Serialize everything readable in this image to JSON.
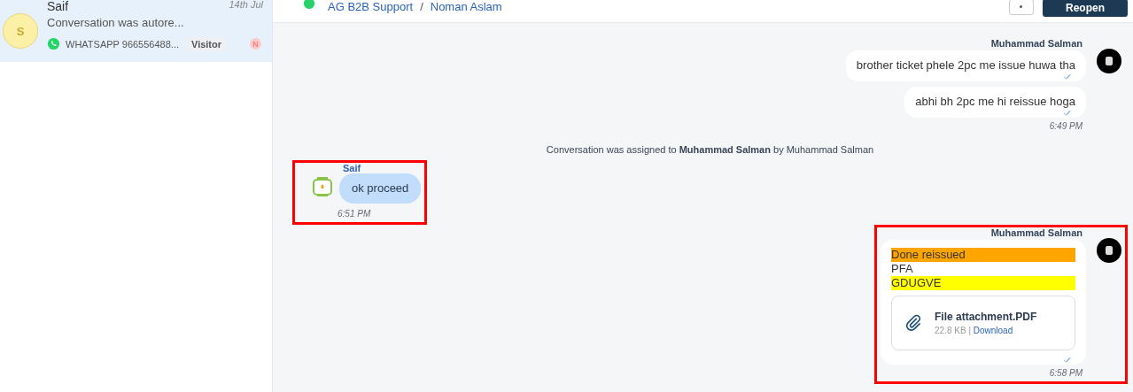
{
  "sidebar": {
    "conversations": [
      {
        "initial": "S",
        "name": "Saif",
        "time": "14th Jul",
        "preview": "Conversation was autore...",
        "channel": "WHATSAPP 966556488...",
        "label": "Visitor",
        "badge": "N",
        "selected": true
      }
    ]
  },
  "header": {
    "breadcrumb": [
      "AG B2B Support",
      "Noman Aslam"
    ],
    "separator": "/",
    "action": "Reopen"
  },
  "messages": [
    {
      "kind": "outgoing",
      "sender": "Muhammad Salman",
      "highlighted": false,
      "time": "6:49 PM",
      "bubbles": [
        {
          "lines": [
            {
              "text": "brother ticket phele 2pc me issue huwa tha"
            }
          ],
          "read": true
        },
        {
          "lines": [
            {
              "text": "abhi bh 2pc me hi reissue hoga"
            }
          ],
          "read": true
        }
      ]
    },
    {
      "kind": "activity",
      "text": "Conversation was assigned to **Muhammad Salman** by Muhammad Salman"
    },
    {
      "kind": "incoming",
      "sender": "Saif",
      "highlighted": true,
      "time": "6:51 PM",
      "bubbles": [
        {
          "lines": [
            {
              "text": "ok proceed"
            }
          ]
        }
      ]
    },
    {
      "kind": "outgoing",
      "sender": "Muhammad Salman",
      "highlighted": true,
      "time": "6:58 PM",
      "bubbles": [
        {
          "lines": [
            {
              "text": "Done reissued",
              "color": "#ffa500"
            },
            {
              "text": "PFA"
            },
            {
              "text": "GDUGVE",
              "color": "#ffff00"
            }
          ],
          "attachment": {
            "name": "File attachment.PDF",
            "size": "22.8 KB",
            "separator": "|",
            "action": "Download"
          },
          "read": true
        }
      ]
    }
  ]
}
